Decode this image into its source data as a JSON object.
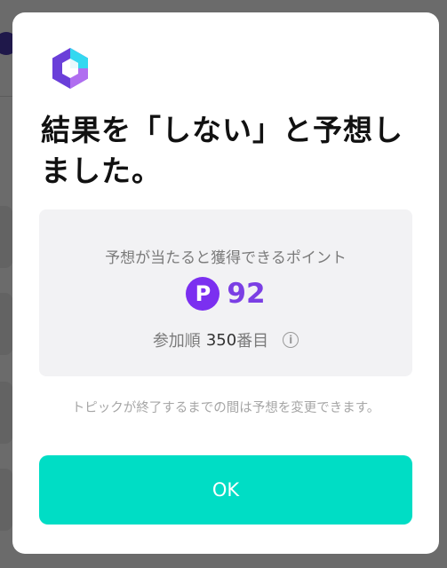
{
  "dialog": {
    "title": "結果を「しない」と予想しました。",
    "info": {
      "label": "予想が当たると獲得できるポイント",
      "point_symbol": "P",
      "points": "92",
      "rank_prefix": "参加順",
      "rank_number": "350",
      "rank_suffix": "番目",
      "info_symbol": "i"
    },
    "note": "トピックが終了するまでの間は予想を変更できます。",
    "ok_label": "OK"
  },
  "colors": {
    "accent": "#00ddc5",
    "points": "#7b3fe4",
    "point_icon": "#7b2ff0"
  },
  "icons": {
    "logo": "app-logo-icon",
    "point": "point-icon",
    "info": "info-icon"
  }
}
